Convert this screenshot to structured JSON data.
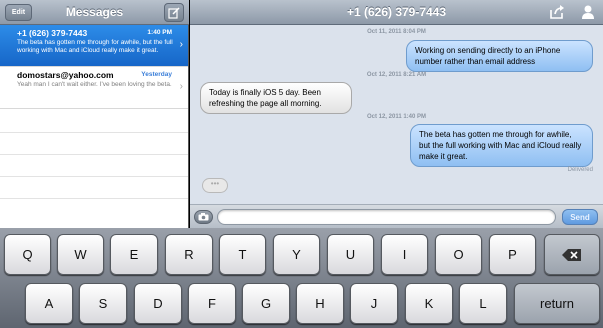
{
  "left_pane": {
    "edit_label": "Edit",
    "title": "Messages",
    "conversations": [
      {
        "name": "+1 (626) 379-7443",
        "time": "1:40 PM",
        "preview": "The beta has gotten me through for awhile, but the full working with Mac and iCloud really make it great.",
        "selected": true
      },
      {
        "name": "domostars@yahoo.com",
        "time": "Yesterday",
        "preview": "Yeah man I can't wait either. I've been loving the beta.",
        "selected": false
      }
    ]
  },
  "conversation": {
    "title": "+1 (626) 379-7443",
    "messages": [
      {
        "timestamp": "Oct 11, 2011 8:04 PM",
        "direction": "outgoing",
        "text": "Working on sending directly to an iPhone number rather than email address"
      },
      {
        "timestamp": "Oct 12, 2011 8:21 AM",
        "direction": "incoming",
        "text": "Today is finally iOS 5 day. Been refreshing the page all morning."
      },
      {
        "timestamp": "Oct 12, 2011 1:40 PM",
        "direction": "outgoing",
        "text": "The beta has gotten me through for awhile, but the full working with Mac and iCloud really make it great."
      }
    ],
    "delivered_label": "Delivered",
    "typing_indicator": "•••",
    "input_value": "",
    "send_label": "Send"
  },
  "keyboard": {
    "row1": [
      "Q",
      "W",
      "E",
      "R",
      "T",
      "Y",
      "U",
      "I",
      "O",
      "P"
    ],
    "row2": [
      "A",
      "S",
      "D",
      "F",
      "G",
      "H",
      "J",
      "K",
      "L"
    ],
    "backspace_icon": "backspace-icon",
    "return_label": "return"
  },
  "colors": {
    "selected_row": "#1f77d9",
    "outgoing_bubble": "#a8d0fb",
    "send_button": "#6aa4e6"
  }
}
